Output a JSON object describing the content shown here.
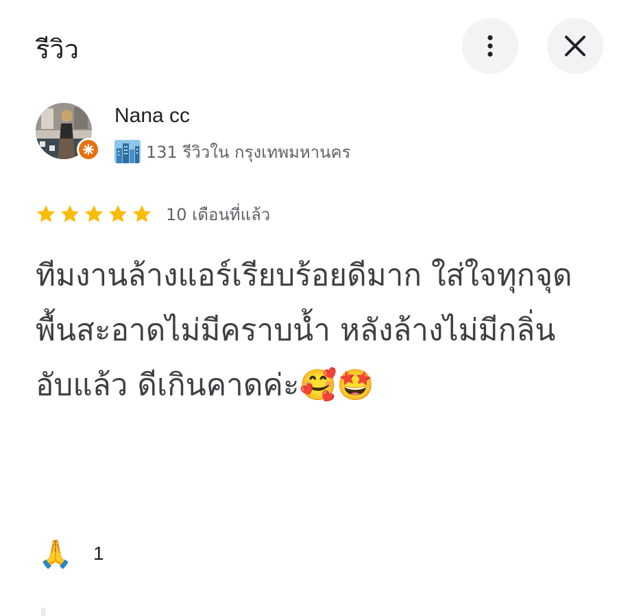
{
  "header": {
    "title": "รีวิว",
    "more_icon": "more-vert-icon",
    "close_icon": "close-icon"
  },
  "reviewer": {
    "name": "Nana cc",
    "badge_icon": "local-guide-badge-icon",
    "meta_icon": "city-skyline-icon",
    "meta_text": "131 รีวิวใน กรุงเทพมหานคร"
  },
  "review": {
    "rating": 5,
    "max_rating": 5,
    "star_color": "#fbbc04",
    "date": "10 เดือนที่แล้ว",
    "text": "ทีมงานล้างแอร์เรียบร้อยดีมาก ใส่ใจทุกจุด พื้นสะอาดไม่มีคราบน้ำ หลังล้างไม่มีกลิ่นอับแล้ว ดีเกินคาดค่ะ🥰🤩"
  },
  "reaction": {
    "emoji": "🙏",
    "count": "1"
  }
}
